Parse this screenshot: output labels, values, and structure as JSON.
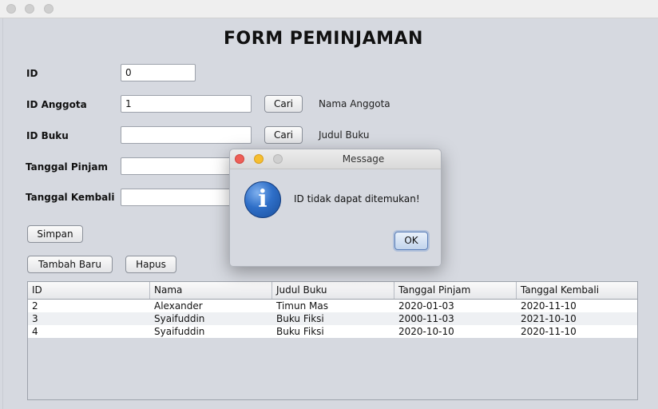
{
  "form": {
    "title": "FORM PEMINJAMAN",
    "labels": {
      "id": "ID",
      "id_anggota": "ID Anggota",
      "id_buku": "ID Buku",
      "tanggal_pinjam": "Tanggal Pinjam",
      "tanggal_kembali": "Tanggal Kembali"
    },
    "values": {
      "id": "0",
      "id_anggota": "1",
      "id_buku": "",
      "tanggal_pinjam": "",
      "tanggal_kembali": ""
    },
    "cari_label": "Cari",
    "nama_anggota": "Nama Anggota",
    "judul_buku": "Judul Buku",
    "buttons": {
      "simpan": "Simpan",
      "tambah_baru": "Tambah Baru",
      "hapus": "Hapus"
    }
  },
  "table": {
    "columns": [
      "ID",
      "Nama",
      "Judul Buku",
      "Tanggal Pinjam",
      "Tanggal Kembali"
    ],
    "rows": [
      [
        "2",
        "Alexander",
        "Timun Mas",
        "2020-01-03",
        "2020-11-10"
      ],
      [
        "3",
        "Syaifuddin",
        "Buku Fiksi",
        "2000-11-03",
        "2021-10-10"
      ],
      [
        "4",
        "Syaifuddin",
        "Buku Fiksi",
        "2020-10-10",
        "2020-11-10"
      ]
    ]
  },
  "dialog": {
    "title": "Message",
    "message": "ID tidak dapat ditemukan!",
    "ok_label": "OK",
    "icon": "info-icon"
  },
  "colors": {
    "background": "#d6d9e0",
    "dialog_close": "#ee5f57",
    "dialog_minimize": "#f6be2f",
    "dialog_zoom": "#cfcfcf"
  }
}
